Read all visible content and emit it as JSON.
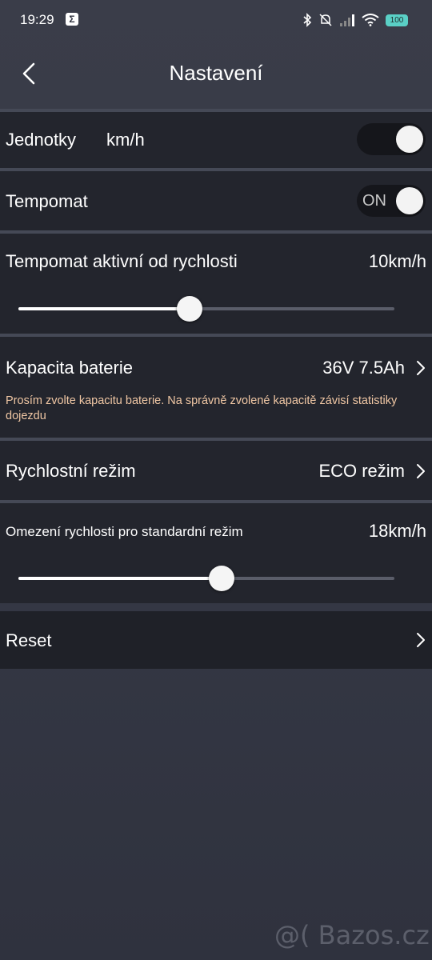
{
  "status": {
    "time": "19:29",
    "battery": "100"
  },
  "header": {
    "title": "Nastavení"
  },
  "units": {
    "label": "Jednotky",
    "value": "km/h",
    "toggle_on": true
  },
  "cruise": {
    "label": "Tempomat",
    "toggle_text": "ON",
    "toggle_on": true
  },
  "cruise_speed": {
    "label": "Tempomat aktivní od rychlosti",
    "value": "10km/h",
    "slider_fraction": 0.455
  },
  "battery_capacity": {
    "label": "Kapacita baterie",
    "value": "36V 7.5Ah",
    "note": "Prosím zvolte kapacitu baterie. Na správně zvolené kapacitě závisí statistiky dojezdu"
  },
  "speed_mode": {
    "label": "Rychlostní režim",
    "value": "ECO režim"
  },
  "speed_limit": {
    "label": "Omezení rychlosti pro standardní režim",
    "value": "18km/h",
    "slider_fraction": 0.54
  },
  "reset": {
    "label": "Reset"
  },
  "watermark": "@( Bazos.cz",
  "colors": {
    "panel": "#23252d",
    "background": "#383b47",
    "note": "#f0c7a4",
    "battery": "#5ad0c6"
  },
  "icons": [
    "back-arrow-icon",
    "chevron-right-icon",
    "bluetooth-icon",
    "mute-icon",
    "signal-icon",
    "wifi-icon",
    "battery-icon"
  ]
}
